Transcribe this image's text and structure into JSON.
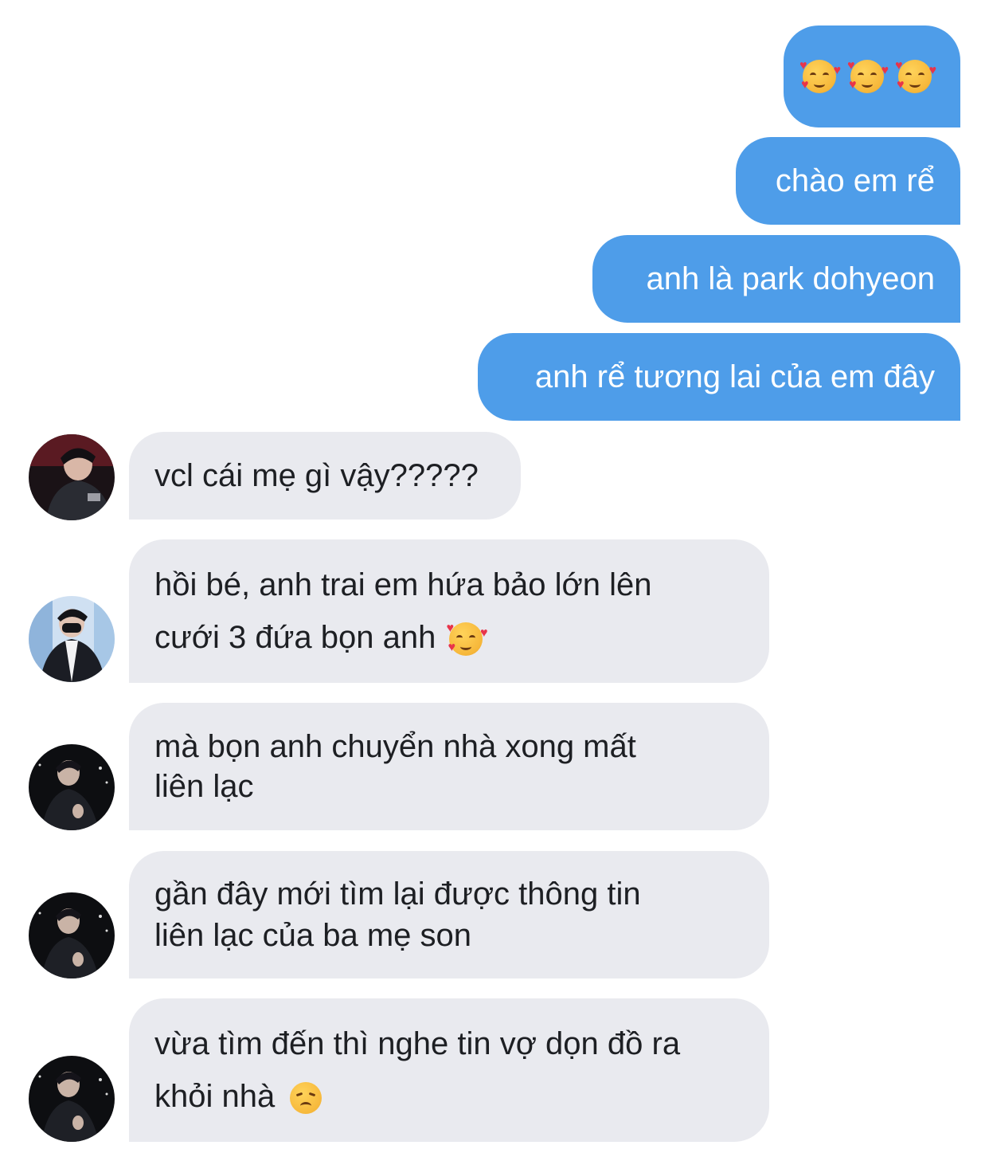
{
  "outgoing": [
    {
      "id": "out-emoji",
      "emoji": [
        "smiling-face-with-hearts",
        "smiling-face-with-hearts",
        "smiling-face-with-hearts"
      ]
    },
    {
      "id": "out-1",
      "text": "chào em rể"
    },
    {
      "id": "out-2",
      "text": "anh là park dohyeon"
    },
    {
      "id": "out-3",
      "text": "anh rể tương lai của em đây"
    }
  ],
  "incoming": [
    {
      "id": "in-1",
      "lines": [
        "vcl cái mẹ gì vậy?????"
      ],
      "avatar": "avatar-player-red"
    },
    {
      "id": "in-2",
      "lines": [
        "hồi bé, anh trai em hứa bảo lớn lên",
        "cưới 3 đứa bọn anh"
      ],
      "trailing_emoji": "smiling-face-with-hearts",
      "avatar": "avatar-masked-blue"
    },
    {
      "id": "in-3",
      "lines": [
        "mà bọn anh chuyển nhà xong mất",
        "liên lạc"
      ],
      "avatar": "avatar-dark-suit"
    },
    {
      "id": "in-4",
      "lines": [
        "gần đây mới tìm lại được thông tin",
        "liên lạc của ba mẹ son"
      ],
      "avatar": "avatar-dark-suit"
    },
    {
      "id": "in-5",
      "lines": [
        "vừa tìm đến thì nghe tin vợ dọn đồ ra",
        "khỏi nhà"
      ],
      "trailing_emoji": "disappointed-face",
      "avatar": "avatar-dark-suit"
    }
  ],
  "colors": {
    "outgoing_bubble": "#4e9de9",
    "incoming_bubble": "#e9eaef",
    "incoming_text": "#1d1f23",
    "outgoing_text": "#ffffff"
  }
}
